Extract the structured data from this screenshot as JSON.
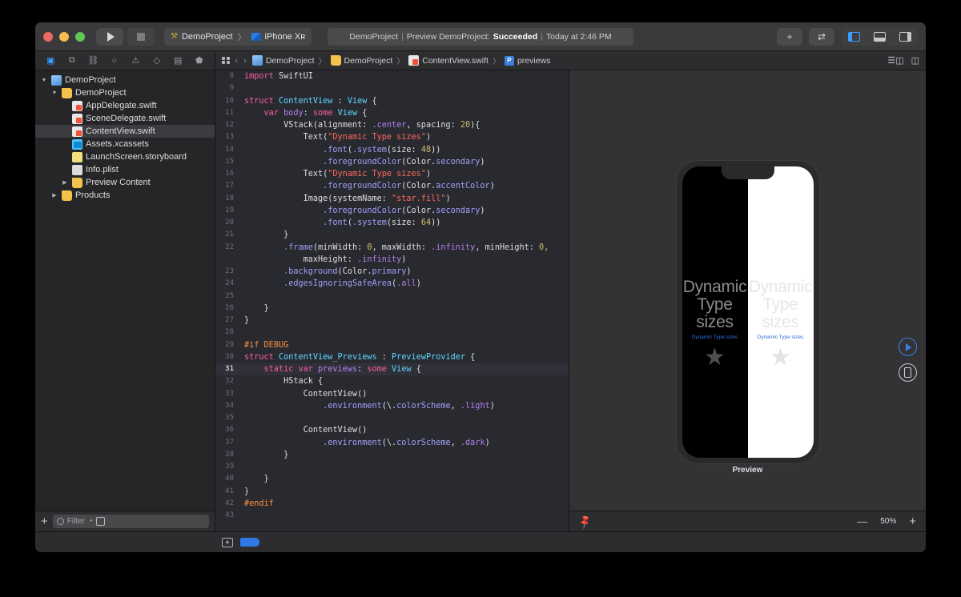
{
  "window": {
    "traffic_lights": [
      "close",
      "minimize",
      "maximize"
    ],
    "toolbar": {
      "run_label": "run-button",
      "stop_label": "stop-button",
      "scheme_project": "DemoProject",
      "scheme_separator": "〉",
      "scheme_device": "iPhone Xʀ",
      "add_label": "+",
      "swap_label": "⇄"
    },
    "status": {
      "project": "DemoProject",
      "sep1": "|",
      "action": "Preview DemoProject:",
      "result": "Succeeded",
      "sep2": "|",
      "time": "Today at 2:46 PM"
    }
  },
  "navigator": {
    "tabs": [
      {
        "name": "project-navigator",
        "glyph": "▣",
        "active": true
      },
      {
        "name": "source-control-navigator",
        "glyph": "⧉",
        "active": false
      },
      {
        "name": "symbol-navigator",
        "glyph": "⛓",
        "active": false
      },
      {
        "name": "find-navigator",
        "glyph": "○",
        "active": false
      },
      {
        "name": "issue-navigator",
        "glyph": "⚠",
        "active": false
      },
      {
        "name": "test-navigator",
        "glyph": "◇",
        "active": false
      },
      {
        "name": "debug-navigator",
        "glyph": "▤",
        "active": false
      },
      {
        "name": "breakpoint-navigator",
        "glyph": "⬟",
        "active": false
      },
      {
        "name": "report-navigator",
        "glyph": "⬜",
        "active": false
      }
    ],
    "tree": [
      {
        "label": "DemoProject",
        "icon": "proj",
        "indent": 0,
        "disclosure": "open",
        "selected": false
      },
      {
        "label": "DemoProject",
        "icon": "folder",
        "indent": 1,
        "disclosure": "open",
        "selected": false
      },
      {
        "label": "AppDelegate.swift",
        "icon": "swift",
        "indent": 2,
        "disclosure": "none",
        "selected": false
      },
      {
        "label": "SceneDelegate.swift",
        "icon": "swift",
        "indent": 2,
        "disclosure": "none",
        "selected": false
      },
      {
        "label": "ContentView.swift",
        "icon": "swift",
        "indent": 2,
        "disclosure": "none",
        "selected": true
      },
      {
        "label": "Assets.xcassets",
        "icon": "assets",
        "indent": 2,
        "disclosure": "none",
        "selected": false
      },
      {
        "label": "LaunchScreen.storyboard",
        "icon": "story",
        "indent": 2,
        "disclosure": "none",
        "selected": false
      },
      {
        "label": "Info.plist",
        "icon": "plist",
        "indent": 2,
        "disclosure": "none",
        "selected": false
      },
      {
        "label": "Preview Content",
        "icon": "folder",
        "indent": 2,
        "disclosure": "closed",
        "selected": false
      },
      {
        "label": "Products",
        "icon": "folder",
        "indent": 1,
        "disclosure": "closed",
        "selected": false
      }
    ],
    "filter": {
      "add_label": "+",
      "placeholder": "Filter",
      "recent_label": "◔",
      "filter_toggle_label": "▣"
    }
  },
  "jumpbar": {
    "back": "‹",
    "forward": "›",
    "crumbs": [
      {
        "label": "DemoProject",
        "icon": "proj"
      },
      {
        "label": "DemoProject",
        "icon": "folder"
      },
      {
        "label": "ContentView.swift",
        "icon": "swift"
      },
      {
        "label": "previews",
        "icon": "pbadge"
      }
    ],
    "separator": "〉",
    "right_icons": [
      "minimap-icon",
      "assistant-editor-icon"
    ]
  },
  "code": {
    "lines": [
      {
        "n": "8",
        "current": false,
        "tokens": [
          {
            "t": "import ",
            "c": "kw"
          },
          {
            "t": "SwiftUI",
            "c": "plain"
          }
        ]
      },
      {
        "n": "9",
        "current": false,
        "tokens": []
      },
      {
        "n": "10",
        "current": false,
        "tokens": [
          {
            "t": "struct ",
            "c": "kw"
          },
          {
            "t": "ContentView",
            "c": "type"
          },
          {
            "t": " : ",
            "c": "plain"
          },
          {
            "t": "View",
            "c": "type"
          },
          {
            "t": " {",
            "c": "plain"
          }
        ]
      },
      {
        "n": "11",
        "current": false,
        "tokens": [
          {
            "t": "    ",
            "c": "plain"
          },
          {
            "t": "var ",
            "c": "kw"
          },
          {
            "t": "body",
            "c": "var"
          },
          {
            "t": ": ",
            "c": "plain"
          },
          {
            "t": "some ",
            "c": "kw"
          },
          {
            "t": "View",
            "c": "type"
          },
          {
            "t": " {",
            "c": "plain"
          }
        ]
      },
      {
        "n": "12",
        "current": false,
        "tokens": [
          {
            "t": "        VStack(alignment: ",
            "c": "plain"
          },
          {
            "t": ".center",
            "c": "prop"
          },
          {
            "t": ", spacing: ",
            "c": "plain"
          },
          {
            "t": "20",
            "c": "num"
          },
          {
            "t": "){",
            "c": "plain"
          }
        ]
      },
      {
        "n": "13",
        "current": false,
        "tokens": [
          {
            "t": "            Text(",
            "c": "plain"
          },
          {
            "t": "\"Dynamic Type sizes\"",
            "c": "str"
          },
          {
            "t": ")",
            "c": "plain"
          }
        ]
      },
      {
        "n": "14",
        "current": false,
        "tokens": [
          {
            "t": "                ",
            "c": "plain"
          },
          {
            "t": ".font",
            "c": "meth"
          },
          {
            "t": "(",
            "c": "plain"
          },
          {
            "t": ".system",
            "c": "meth"
          },
          {
            "t": "(size: ",
            "c": "plain"
          },
          {
            "t": "48",
            "c": "num"
          },
          {
            "t": "))",
            "c": "plain"
          }
        ]
      },
      {
        "n": "15",
        "current": false,
        "tokens": [
          {
            "t": "                ",
            "c": "plain"
          },
          {
            "t": ".foregroundColor",
            "c": "meth"
          },
          {
            "t": "(Color.",
            "c": "plain"
          },
          {
            "t": "secondary",
            "c": "meth"
          },
          {
            "t": ")",
            "c": "plain"
          }
        ]
      },
      {
        "n": "16",
        "current": false,
        "tokens": [
          {
            "t": "            Text(",
            "c": "plain"
          },
          {
            "t": "\"Dynamic Type sizes\"",
            "c": "str"
          },
          {
            "t": ")",
            "c": "plain"
          }
        ]
      },
      {
        "n": "17",
        "current": false,
        "tokens": [
          {
            "t": "                ",
            "c": "plain"
          },
          {
            "t": ".foregroundColor",
            "c": "meth"
          },
          {
            "t": "(Color.",
            "c": "plain"
          },
          {
            "t": "accentColor",
            "c": "meth"
          },
          {
            "t": ")",
            "c": "plain"
          }
        ]
      },
      {
        "n": "18",
        "current": false,
        "tokens": [
          {
            "t": "            Image(systemName: ",
            "c": "plain"
          },
          {
            "t": "\"star.fill\"",
            "c": "str"
          },
          {
            "t": ")",
            "c": "plain"
          }
        ]
      },
      {
        "n": "19",
        "current": false,
        "tokens": [
          {
            "t": "                ",
            "c": "plain"
          },
          {
            "t": ".foregroundColor",
            "c": "meth"
          },
          {
            "t": "(Color.",
            "c": "plain"
          },
          {
            "t": "secondary",
            "c": "meth"
          },
          {
            "t": ")",
            "c": "plain"
          }
        ]
      },
      {
        "n": "20",
        "current": false,
        "tokens": [
          {
            "t": "                ",
            "c": "plain"
          },
          {
            "t": ".font",
            "c": "meth"
          },
          {
            "t": "(",
            "c": "plain"
          },
          {
            "t": ".system",
            "c": "meth"
          },
          {
            "t": "(size: ",
            "c": "plain"
          },
          {
            "t": "64",
            "c": "num"
          },
          {
            "t": "))",
            "c": "plain"
          }
        ]
      },
      {
        "n": "21",
        "current": false,
        "tokens": [
          {
            "t": "        }",
            "c": "plain"
          }
        ]
      },
      {
        "n": "22",
        "current": false,
        "tokens": [
          {
            "t": "        ",
            "c": "plain"
          },
          {
            "t": ".frame",
            "c": "meth"
          },
          {
            "t": "(minWidth: ",
            "c": "plain"
          },
          {
            "t": "0",
            "c": "num"
          },
          {
            "t": ", maxWidth: ",
            "c": "plain"
          },
          {
            "t": ".infinity",
            "c": "prop"
          },
          {
            "t": ", minHeight: ",
            "c": "plain"
          },
          {
            "t": "0,",
            "c": "num"
          }
        ]
      },
      {
        "n": "",
        "current": false,
        "tokens": [
          {
            "t": "            maxHeight: ",
            "c": "plain"
          },
          {
            "t": ".infinity",
            "c": "prop"
          },
          {
            "t": ")",
            "c": "plain"
          }
        ]
      },
      {
        "n": "23",
        "current": false,
        "tokens": [
          {
            "t": "        ",
            "c": "plain"
          },
          {
            "t": ".background",
            "c": "meth"
          },
          {
            "t": "(Color.",
            "c": "plain"
          },
          {
            "t": "primary",
            "c": "meth"
          },
          {
            "t": ")",
            "c": "plain"
          }
        ]
      },
      {
        "n": "24",
        "current": false,
        "tokens": [
          {
            "t": "        ",
            "c": "plain"
          },
          {
            "t": ".edgesIgnoringSafeArea",
            "c": "meth"
          },
          {
            "t": "(",
            "c": "plain"
          },
          {
            "t": ".all",
            "c": "prop"
          },
          {
            "t": ")",
            "c": "plain"
          }
        ]
      },
      {
        "n": "25",
        "current": false,
        "tokens": []
      },
      {
        "n": "26",
        "current": false,
        "tokens": [
          {
            "t": "    }",
            "c": "plain"
          }
        ]
      },
      {
        "n": "27",
        "current": false,
        "tokens": [
          {
            "t": "}",
            "c": "plain"
          }
        ]
      },
      {
        "n": "28",
        "current": false,
        "tokens": []
      },
      {
        "n": "29",
        "current": false,
        "tokens": [
          {
            "t": "#if ",
            "c": "pre"
          },
          {
            "t": "DEBUG",
            "c": "pre"
          }
        ]
      },
      {
        "n": "30",
        "current": false,
        "tokens": [
          {
            "t": "struct ",
            "c": "kw"
          },
          {
            "t": "ContentView_Previews",
            "c": "type"
          },
          {
            "t": " : ",
            "c": "plain"
          },
          {
            "t": "PreviewProvider",
            "c": "type"
          },
          {
            "t": " {",
            "c": "plain"
          }
        ]
      },
      {
        "n": "31",
        "current": true,
        "tokens": [
          {
            "t": "    ",
            "c": "plain"
          },
          {
            "t": "static var ",
            "c": "kw"
          },
          {
            "t": "previews",
            "c": "var"
          },
          {
            "t": ": ",
            "c": "plain"
          },
          {
            "t": "some ",
            "c": "kw"
          },
          {
            "t": "View",
            "c": "type"
          },
          {
            "t": " {",
            "c": "plain"
          }
        ]
      },
      {
        "n": "32",
        "current": false,
        "tokens": [
          {
            "t": "        HStack {",
            "c": "plain"
          }
        ]
      },
      {
        "n": "33",
        "current": false,
        "tokens": [
          {
            "t": "            ContentView()",
            "c": "plain"
          }
        ]
      },
      {
        "n": "34",
        "current": false,
        "tokens": [
          {
            "t": "                ",
            "c": "plain"
          },
          {
            "t": ".environment",
            "c": "meth"
          },
          {
            "t": "(\\.",
            "c": "plain"
          },
          {
            "t": "colorScheme",
            "c": "meth"
          },
          {
            "t": ", ",
            "c": "plain"
          },
          {
            "t": ".light",
            "c": "prop"
          },
          {
            "t": ")",
            "c": "plain"
          }
        ]
      },
      {
        "n": "35",
        "current": false,
        "tokens": []
      },
      {
        "n": "36",
        "current": false,
        "tokens": [
          {
            "t": "            ContentView()",
            "c": "plain"
          }
        ]
      },
      {
        "n": "37",
        "current": false,
        "tokens": [
          {
            "t": "                ",
            "c": "plain"
          },
          {
            "t": ".environment",
            "c": "meth"
          },
          {
            "t": "(\\.",
            "c": "plain"
          },
          {
            "t": "colorScheme",
            "c": "meth"
          },
          {
            "t": ", ",
            "c": "plain"
          },
          {
            "t": ".dark",
            "c": "prop"
          },
          {
            "t": ")",
            "c": "plain"
          }
        ]
      },
      {
        "n": "38",
        "current": false,
        "tokens": [
          {
            "t": "        }",
            "c": "plain"
          }
        ]
      },
      {
        "n": "39",
        "current": false,
        "tokens": []
      },
      {
        "n": "40",
        "current": false,
        "tokens": [
          {
            "t": "    }",
            "c": "plain"
          }
        ]
      },
      {
        "n": "41",
        "current": false,
        "tokens": [
          {
            "t": "}",
            "c": "plain"
          }
        ]
      },
      {
        "n": "42",
        "current": false,
        "tokens": [
          {
            "t": "#endif",
            "c": "pre"
          }
        ]
      },
      {
        "n": "43",
        "current": false,
        "tokens": []
      }
    ]
  },
  "preview": {
    "label": "Preview",
    "device_name": "iPhone Xʀ",
    "dark_half": {
      "title": "Dynamic\nType\nsizes",
      "accent_text": "Dynamic Type sizes",
      "star": "★"
    },
    "light_half": {
      "title": "Dynamic\nType\nsizes",
      "accent_text": "Dynamic Type sizes",
      "star": "★"
    },
    "controls": {
      "live_preview": "play-button",
      "device_preview": "device-button"
    },
    "bottom": {
      "pin": "📌",
      "zoom_out": "—",
      "zoom_level": "50%",
      "zoom_in": "+"
    }
  },
  "bottombar": {
    "image_label": "image-button",
    "tag_label": "blue-tag"
  },
  "colors": {
    "accent": "#3b7fe0",
    "editor_bg": "#292a30",
    "chrome_bg": "#2d2d30",
    "keyword": "#fc5fa3",
    "type": "#5dd8ff",
    "string": "#fc6a5d",
    "number": "#d0bf69",
    "method": "#a0a0f8",
    "property": "#b281eb",
    "preprocessor": "#fd8f3f"
  }
}
